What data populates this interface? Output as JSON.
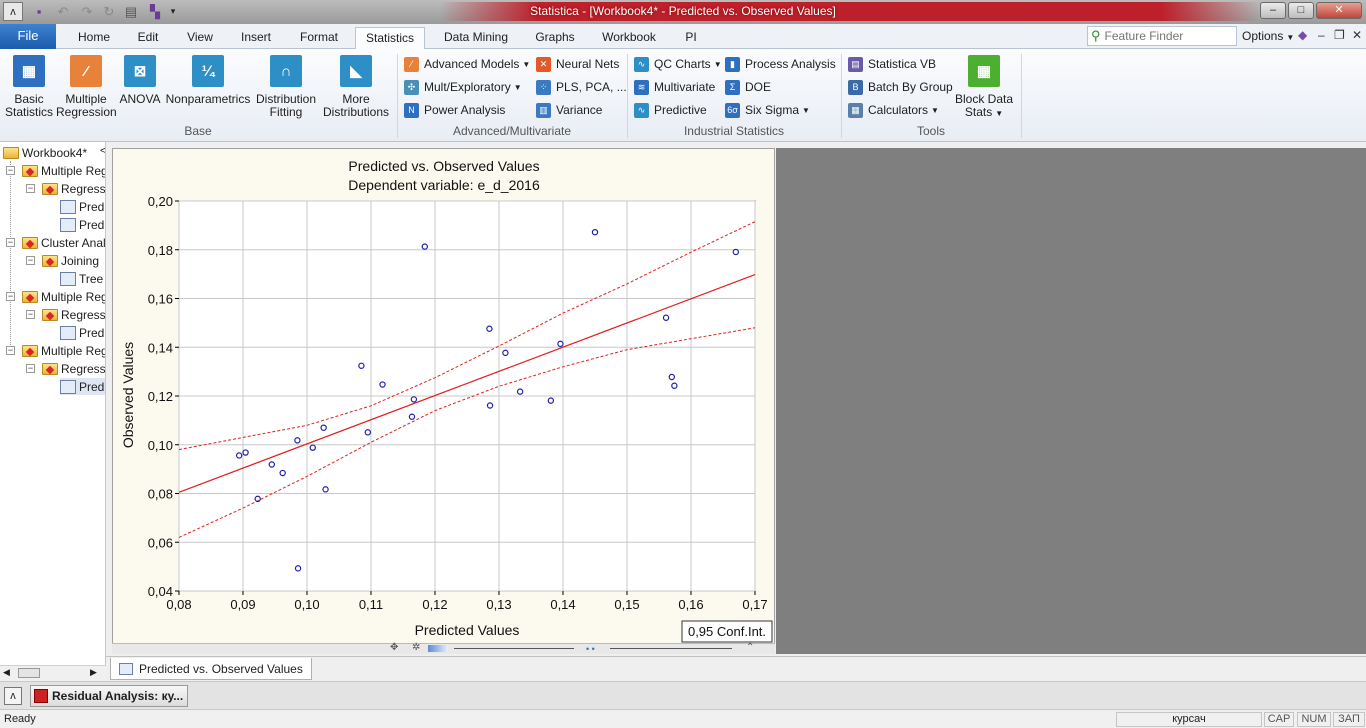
{
  "window": {
    "title": "Statistica - [Workbook4* - Predicted vs. Observed Values]",
    "controls": [
      "–",
      "□",
      "✕"
    ]
  },
  "quick_access_icons": [
    "app-icon",
    "save-icon",
    "undo-icon",
    "redo-icon",
    "repeat-icon",
    "print-icon",
    "customize-icon"
  ],
  "tabs": {
    "file": "File",
    "items": [
      "Home",
      "Edit",
      "View",
      "Insert",
      "Format",
      "Statistics",
      "Data Mining",
      "Graphs",
      "Workbook",
      "PI"
    ],
    "active": "Statistics"
  },
  "feature_finder": {
    "placeholder": "Feature Finder"
  },
  "options_label": "Options",
  "ribbon": {
    "base": {
      "label": "Base",
      "buttons": [
        {
          "line1": "Basic",
          "line2": "Statistics",
          "icon": "basic-statistics-icon",
          "color": "#2e6fbf"
        },
        {
          "line1": "Multiple",
          "line2": "Regression",
          "icon": "multiple-regression-icon",
          "color": "#e8823a"
        },
        {
          "line1": "ANOVA",
          "line2": "",
          "icon": "anova-icon",
          "color": "#2e8fc7"
        },
        {
          "line1": "Nonparametrics",
          "line2": "",
          "icon": "nonparametrics-icon",
          "color": "#2e8fc7"
        },
        {
          "line1": "Distribution",
          "line2": "Fitting",
          "icon": "distribution-fitting-icon",
          "color": "#2e8fc7"
        },
        {
          "line1": "More",
          "line2": "Distributions",
          "icon": "more-distributions-icon",
          "color": "#2e8fc7"
        }
      ]
    },
    "advanced": {
      "label": "Advanced/Multivariate",
      "items": [
        "Advanced Models",
        "Mult/Exploratory",
        "Power Analysis",
        "Neural Nets",
        "PLS, PCA, ...",
        "Variance"
      ]
    },
    "industrial": {
      "label": "Industrial Statistics",
      "items": [
        "QC Charts",
        "Multivariate",
        "Predictive",
        "Process Analysis",
        "DOE",
        "Six Sigma"
      ]
    },
    "tools": {
      "label": "Tools",
      "items": [
        "Statistica VB",
        "Batch By Group",
        "Calculators"
      ],
      "big_line1": "Block Data",
      "big_line2": "Stats"
    }
  },
  "tree": {
    "root": "Workbook4*",
    "nodes": [
      "Multiple Regression",
      "Regression",
      "Predicted",
      "Predicted",
      "Cluster Analysis",
      "Joining",
      "Tree",
      "Multiple Regression",
      "Regression",
      "Predicted",
      "Multiple Regression",
      "Regression",
      "Predicted"
    ]
  },
  "chart_data": {
    "type": "scatter",
    "title": "Predicted vs. Observed Values",
    "subtitle": "Dependent variable: e_d_2016",
    "xlabel": "Predicted Values",
    "ylabel": "Observed Values",
    "xlim": [
      0.08,
      0.17
    ],
    "ylim": [
      0.04,
      0.2
    ],
    "xticks": [
      "0,08",
      "0,09",
      "0,10",
      "0,11",
      "0,12",
      "0,13",
      "0,14",
      "0,15",
      "0,16",
      "0,17"
    ],
    "yticks": [
      "0,04",
      "0,06",
      "0,08",
      "0,10",
      "0,12",
      "0,14",
      "0,16",
      "0,18",
      "0,20"
    ],
    "grid": true,
    "legend": "0,95 Conf.Int.",
    "points": [
      [
        0.0894,
        0.0956
      ],
      [
        0.0904,
        0.0968
      ],
      [
        0.0923,
        0.0778
      ],
      [
        0.0945,
        0.0919
      ],
      [
        0.0962,
        0.0884
      ],
      [
        0.0985,
        0.1018
      ],
      [
        0.0986,
        0.0493
      ],
      [
        0.1009,
        0.0988
      ],
      [
        0.1026,
        0.107
      ],
      [
        0.1029,
        0.0817
      ],
      [
        0.1085,
        0.1324
      ],
      [
        0.1095,
        0.1051
      ],
      [
        0.1118,
        0.1247
      ],
      [
        0.1164,
        0.1115
      ],
      [
        0.1167,
        0.1186
      ],
      [
        0.1184,
        0.1813
      ],
      [
        0.1285,
        0.1476
      ],
      [
        0.1286,
        0.1161
      ],
      [
        0.131,
        0.1377
      ],
      [
        0.1333,
        0.1218
      ],
      [
        0.1381,
        0.1181
      ],
      [
        0.1396,
        0.1414
      ],
      [
        0.145,
        0.1872
      ],
      [
        0.1561,
        0.1521
      ],
      [
        0.157,
        0.1278
      ],
      [
        0.1574,
        0.1242
      ],
      [
        0.167,
        0.1791
      ]
    ],
    "fit_line": [
      [
        0.08,
        0.0805
      ],
      [
        0.17,
        0.1698
      ]
    ],
    "ci_upper": [
      [
        0.08,
        0.098
      ],
      [
        0.1,
        0.108
      ],
      [
        0.11,
        0.116
      ],
      [
        0.12,
        0.1275
      ],
      [
        0.13,
        0.1405
      ],
      [
        0.14,
        0.154
      ],
      [
        0.15,
        0.166
      ],
      [
        0.16,
        0.179
      ],
      [
        0.17,
        0.1915
      ]
    ],
    "ci_lower": [
      [
        0.08,
        0.062
      ],
      [
        0.09,
        0.074
      ],
      [
        0.1,
        0.087
      ],
      [
        0.11,
        0.101
      ],
      [
        0.12,
        0.114
      ],
      [
        0.13,
        0.124
      ],
      [
        0.14,
        0.132
      ],
      [
        0.15,
        0.139
      ],
      [
        0.16,
        0.1435
      ],
      [
        0.17,
        0.148
      ]
    ],
    "colors": {
      "points": "#1f1fa8",
      "fit": "#e02020",
      "ci": "#e02020",
      "background": "#fcf9ee"
    }
  },
  "sheet_tab": "Predicted vs. Observed Values",
  "taskbar_item": "Residual Analysis: ку...",
  "status": {
    "left": "Ready",
    "layout": "курсач",
    "cap": "CAP",
    "num": "NUM",
    "ovr": "ЗАП"
  }
}
